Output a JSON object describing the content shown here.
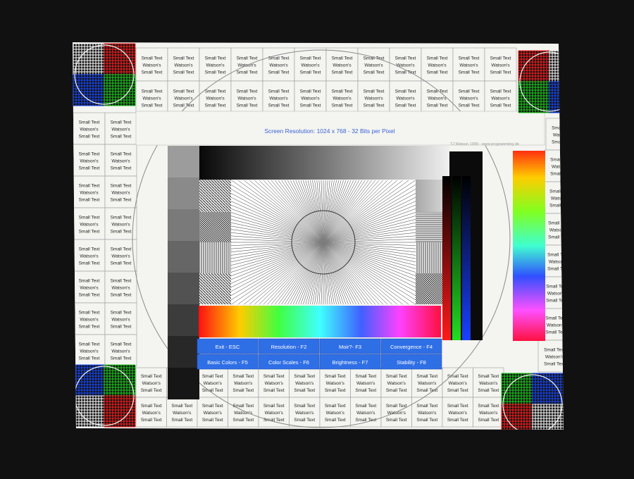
{
  "cell_text": {
    "line1": "Small Text",
    "line2": "Watson's",
    "line3": "Small Text"
  },
  "header": {
    "resolution_text": "Screen Resolution: 1024 x 768 - 32 Bits per Pixel",
    "credit_text": "TJ Watson 1999 - www.programming.de"
  },
  "function_keys": [
    {
      "label": "Exit - ESC"
    },
    {
      "label": "Resolution - F2"
    },
    {
      "label": "Moir?- F3"
    },
    {
      "label": "Convergence - F4"
    },
    {
      "label": "Basic Colors - F5"
    },
    {
      "label": "Color Scales - F6"
    },
    {
      "label": "Brightness - F7"
    },
    {
      "label": "Stability - F8"
    }
  ],
  "colors": {
    "background": "#111111",
    "screen": "#f4f4f0",
    "grid_line": "#9a9a9a",
    "button_fill": "#2f6fe6",
    "button_text": "#ffffff",
    "resolution_text": "#3a63d8",
    "corner_quadrants": [
      "#ffffff",
      "#ff2020",
      "#1a4cff",
      "#20d020"
    ]
  },
  "gray_steps_left": [
    "#9c9c9c",
    "#8a8a8a",
    "#7a7a7a",
    "#666666",
    "#525252",
    "#3c3c3c",
    "#282828",
    "#161616"
  ],
  "color_bars_vertical": [
    "#e01b1b",
    "#25c025",
    "#1b3fe0",
    "#111111"
  ]
}
